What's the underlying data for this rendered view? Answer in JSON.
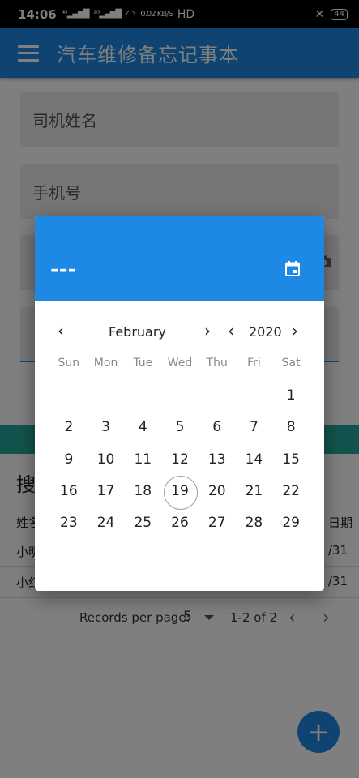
{
  "status_bar": {
    "time": "14:06",
    "signal1": "⁴ᴳ▂▄▆█",
    "signal2": "²ᴳ▂▄▆█",
    "speed": "0.02 KB/S",
    "hd": "HD",
    "battery": "44"
  },
  "app_bar": {
    "title": "汽车维修备忘记事本"
  },
  "form": {
    "driver_name_placeholder": "司机姓名",
    "phone_placeholder": "手机号"
  },
  "search": {
    "title": "搜"
  },
  "table": {
    "headers": {
      "name": "姓名",
      "date": "日期"
    },
    "rows": [
      {
        "name": "小明",
        "date": "/31"
      },
      {
        "name": "小红",
        "date": "/31"
      }
    ]
  },
  "pagination": {
    "label": "Records per page:",
    "value": "5",
    "range": "1-2 of 2"
  },
  "fab": {
    "label": "+"
  },
  "date_picker": {
    "header_year": "___",
    "header_date": "---",
    "month": "February",
    "year": "2020",
    "weekdays": [
      "Sun",
      "Mon",
      "Tue",
      "Wed",
      "Thu",
      "Fri",
      "Sat"
    ],
    "leading_blanks": 6,
    "days": [
      "1",
      "2",
      "3",
      "4",
      "5",
      "6",
      "7",
      "8",
      "9",
      "10",
      "11",
      "12",
      "13",
      "14",
      "15",
      "16",
      "17",
      "18",
      "19",
      "20",
      "21",
      "22",
      "23",
      "24",
      "25",
      "26",
      "27",
      "28",
      "29"
    ],
    "today": "19",
    "colors": {
      "header": "#1e88e5",
      "today_ring": "#9e9e9e"
    }
  }
}
